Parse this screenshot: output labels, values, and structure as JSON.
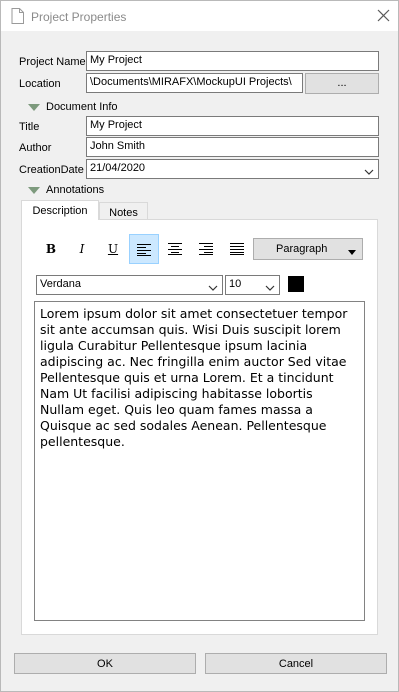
{
  "window": {
    "title": "Project Properties",
    "doc_icon": "document-icon",
    "close_icon": "close-icon"
  },
  "project": {
    "name_label": "Project Name",
    "name_value": "My Project",
    "location_label": "Location",
    "location_value": "\\Documents\\MIRAFX\\MockupUI Projects\\",
    "browse_label": "..."
  },
  "document_info": {
    "section_label": "Document Info",
    "title_label": "Title",
    "title_value": "My Project",
    "author_label": "Author",
    "author_value": "John Smith",
    "creation_label": "CreationDate",
    "creation_value": "21/04/2020"
  },
  "annotations": {
    "section_label": "Annotations",
    "tabs": [
      {
        "label": "Description"
      },
      {
        "label": "Notes"
      }
    ],
    "toolbar": {
      "bold": "B",
      "italic": "I",
      "underline": "U",
      "paragraph": "Paragraph",
      "font": "Verdana",
      "size": "10",
      "color": "#000000"
    },
    "text": "Lorem ipsum dolor sit amet consectetuer tempor sit ante accumsan quis. Wisi Duis suscipit lorem ligula Curabitur Pellentesque ipsum lacinia adipiscing ac. Nec fringilla enim auctor Sed vitae Pellentesque quis et urna Lorem. Et a tincidunt Nam Ut facilisi adipiscing habitasse lobortis Nullam eget. Quis leo quam fames massa a Quisque ac sed sodales Aenean. Pellentesque pellentesque."
  },
  "footer": {
    "ok_label": "OK",
    "cancel_label": "Cancel"
  }
}
